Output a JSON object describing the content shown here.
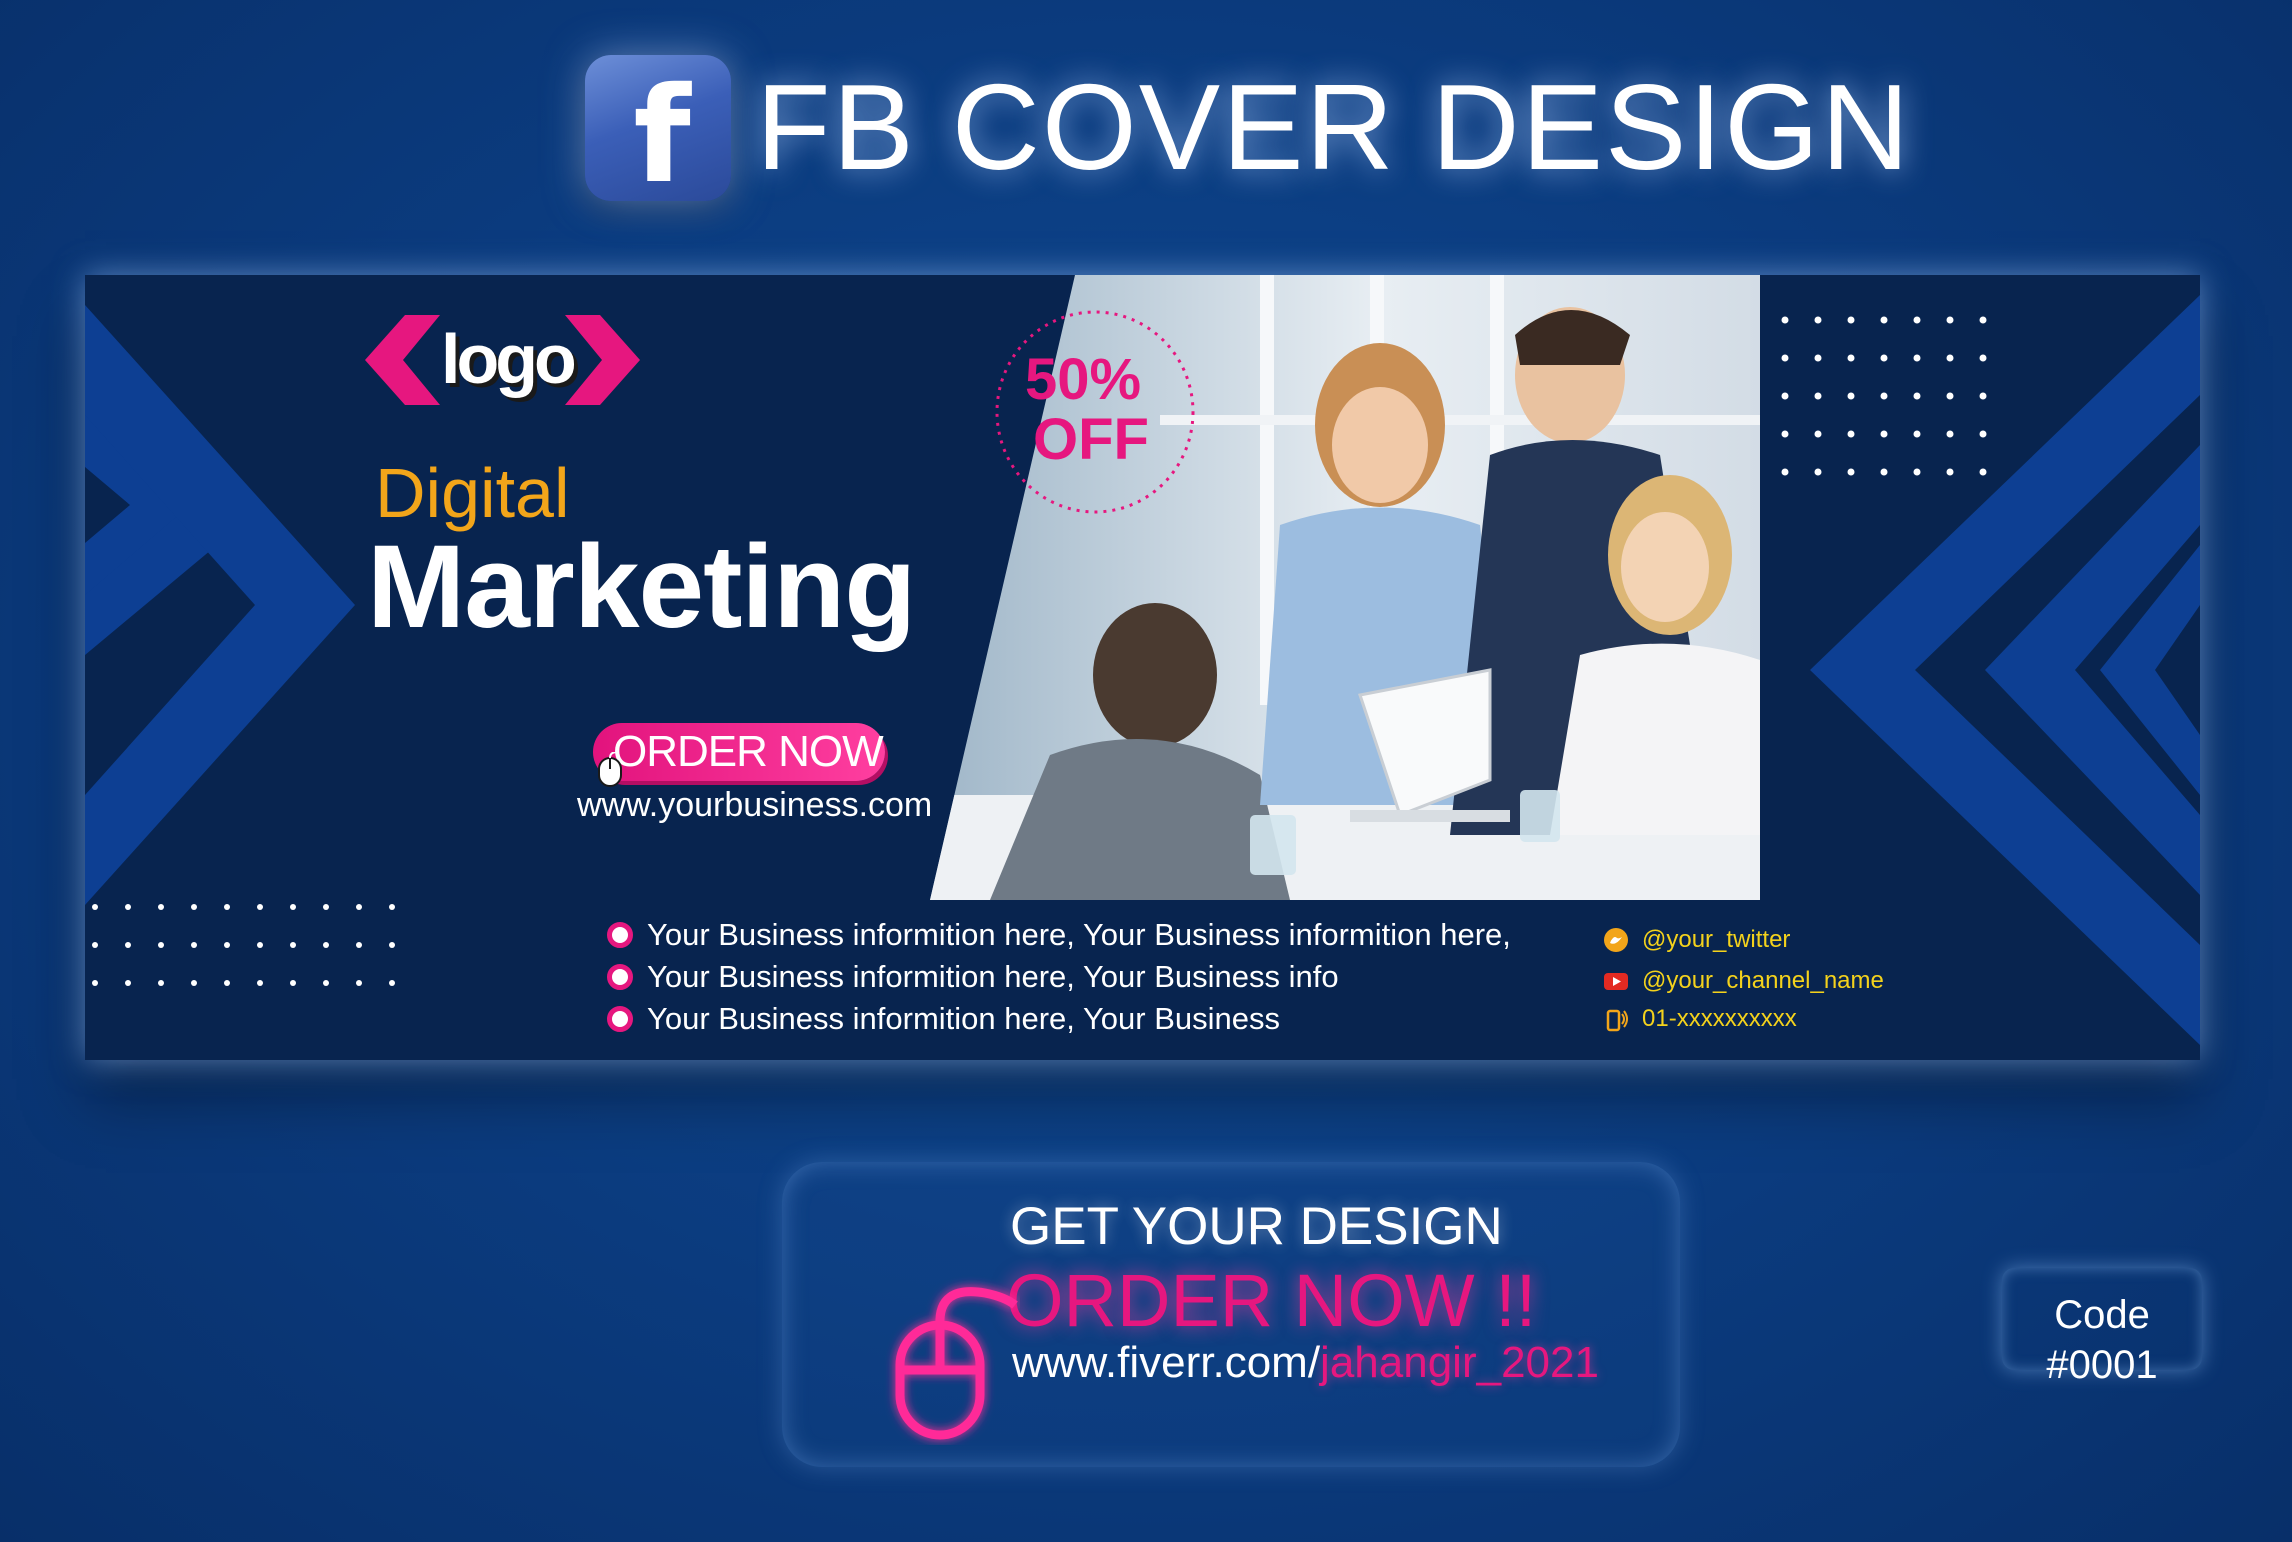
{
  "header": {
    "badge_icon": "facebook-f-icon",
    "badge_letter": "f",
    "title": "FB COVER DESIGN"
  },
  "cover": {
    "logo": {
      "text": "logo"
    },
    "headline": {
      "line1": "Digital",
      "line2": "Marketing"
    },
    "order_button": {
      "label": "ORDER NOW",
      "icon": "mouse-icon"
    },
    "website": "www.yourbusiness.com",
    "discount": {
      "percent": "50%",
      "label": "OFF"
    },
    "photo": {
      "icon": "business-team-photo"
    },
    "info_lines": [
      "Your Business informition here, Your Business informition here,",
      "Your Business informition here, Your Business info",
      "Your Business informition here, Your Business"
    ],
    "social": [
      {
        "icon": "twitter-icon",
        "text": "@your_twitter"
      },
      {
        "icon": "youtube-icon",
        "text": "@your_channel_name"
      },
      {
        "icon": "phone-icon",
        "text": "01-xxxxxxxxxx"
      }
    ]
  },
  "cta": {
    "title": "GET YOUR DESIGN",
    "order": "ORDER NOW !!",
    "url_base": "www.fiverr.com/",
    "url_user": "jahangir_2021",
    "icon": "mouse-icon"
  },
  "code": "Code #0001",
  "colors": {
    "background": "#0b3b7e",
    "cover_bg": "#08244f",
    "accent_pink": "#e6177f",
    "accent_orange": "#f2a51a",
    "accent_yellow": "#f4d21c",
    "chevron_blue": "#0d3f93"
  }
}
